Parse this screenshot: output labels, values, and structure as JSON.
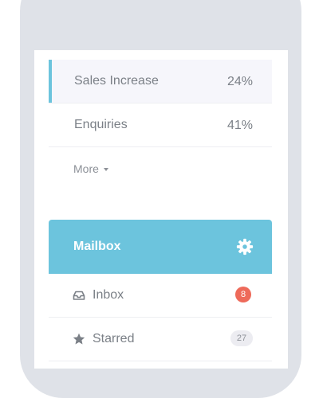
{
  "stats": [
    {
      "label": "Sales Increase",
      "value": "24%",
      "active": true
    },
    {
      "label": "Enquiries",
      "value": "41%",
      "active": false
    }
  ],
  "more_label": "More",
  "mailbox": {
    "title": "Mailbox",
    "accent_color": "#6cc4dd",
    "items": [
      {
        "label": "Inbox",
        "icon": "inbox-icon",
        "badge": "8",
        "badge_color": "#ee6a5a"
      },
      {
        "label": "Starred",
        "icon": "star-icon",
        "badge": "27",
        "badge_color": "#ececf1"
      }
    ]
  }
}
